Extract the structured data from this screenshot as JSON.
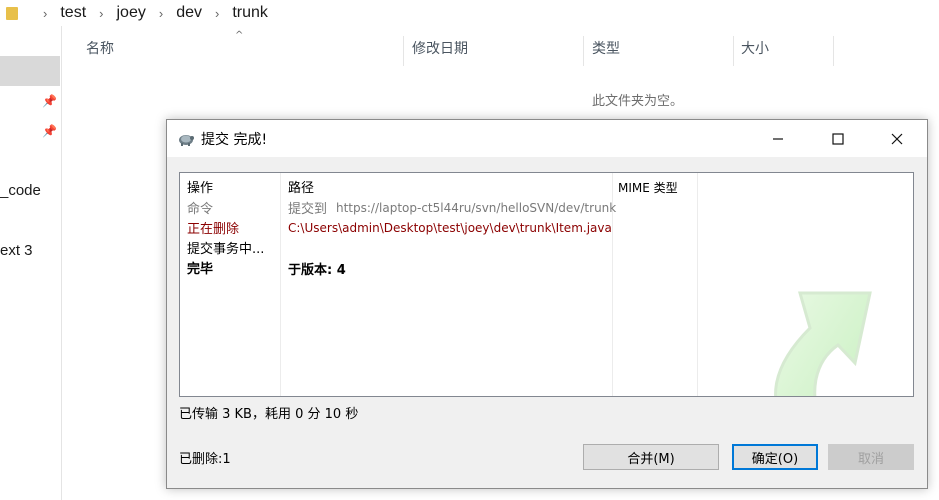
{
  "explorer": {
    "breadcrumb": [
      "test",
      "joey",
      "dev",
      "trunk"
    ],
    "columns": {
      "name": "名称",
      "modified": "修改日期",
      "type": "类型",
      "size": "大小"
    },
    "empty_message": "此文件夹为空。",
    "nav_items": [
      "_code",
      "ext 3"
    ]
  },
  "dialog": {
    "title": "提交 完成!",
    "headers": {
      "action": "操作",
      "path": "路径",
      "mime": "MIME 类型"
    },
    "rows": [
      {
        "action": "命令",
        "path_prefix": "提交到",
        "path": "https://laptop-ct5l44ru/svn/helloSVN/dev/trunk",
        "color": "#7a7a7a",
        "bold": false
      },
      {
        "action": "正在删除",
        "path_prefix": "",
        "path": "C:\\Users\\admin\\Desktop\\test\\joey\\dev\\trunk\\Item.java",
        "color": "#8b0000",
        "bold": false
      },
      {
        "action": "提交事务中...",
        "path_prefix": "",
        "path": "",
        "color": "#000000",
        "bold": false
      },
      {
        "action": "完毕",
        "path_prefix": "",
        "path": "于版本: 4",
        "color": "#000000",
        "bold": true
      }
    ],
    "status": "已传输 3 KB，耗用 0 分 10 秒",
    "deleted": "已删除:1",
    "buttons": {
      "merge": "合并(M)",
      "ok": "确定(O)",
      "cancel": "取消"
    },
    "window_controls": {
      "minimize": "—",
      "maximize": "☐",
      "close": "✕"
    },
    "accent": "#0078d7"
  }
}
